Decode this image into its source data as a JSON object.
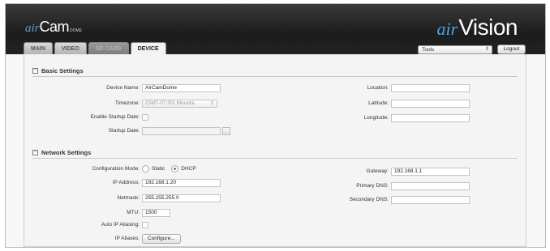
{
  "app": {
    "brand_air": "air",
    "brand_name": "Cam",
    "brand_sub": "DOME",
    "logo_air": "air",
    "logo_name": "Vision"
  },
  "tabs": [
    {
      "label": "MAIN",
      "state": "normal"
    },
    {
      "label": "VIDEO",
      "state": "normal"
    },
    {
      "label": "SD CARD",
      "state": "disabled"
    },
    {
      "label": "DEVICE",
      "state": "active"
    }
  ],
  "toolbar": {
    "tools_label": "Tools",
    "logout_label": "Logout"
  },
  "basic": {
    "title": "Basic Settings",
    "toggle": "−",
    "device_name_label": "Device Name:",
    "device_name_value": "AirCamDome",
    "timezone_label": "Timezone:",
    "timezone_value": "(GMT-07:00) Mounta",
    "startup_date_enable_label": "Enable Startup Date:",
    "startup_date_label": "Startup Date:",
    "startup_date_value": "",
    "location_label": "Location:",
    "location_value": "",
    "latitude_label": "Latitude:",
    "latitude_value": "",
    "longitude_label": "Longitude:",
    "longitude_value": ""
  },
  "network": {
    "title": "Network Settings",
    "toggle": "−",
    "config_mode_label": "Configuration Mode:",
    "mode_static": "Static",
    "mode_dhcp": "DHCP",
    "selected_mode": "DHCP",
    "ip_label": "IP Address:",
    "ip_value": "192.168.1.20",
    "netmask_label": "Netmask:",
    "netmask_value": "255.255.255.0",
    "mtu_label": "MTU:",
    "mtu_value": "1500",
    "auto_ip_label": "Auto IP Aliasing:",
    "ip_aliases_label": "IP Aliases:",
    "configure_label": "Configure...",
    "gateway_label": "Gateway:",
    "gateway_value": "192.168.1.1",
    "primary_dns_label": "Primary DNS:",
    "primary_dns_value": "",
    "secondary_dns_label": "Secondary DNS:",
    "secondary_dns_value": ""
  },
  "colors": {
    "accent": "#4ea3e0",
    "header_bg": "#222222"
  }
}
